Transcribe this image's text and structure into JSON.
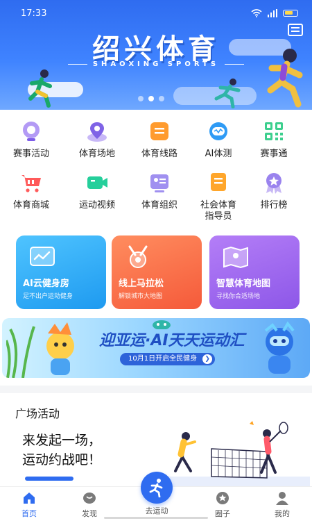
{
  "status_bar": {
    "time": "17:33"
  },
  "hero": {
    "title": "绍兴体育",
    "subtitle": "SHAOXING SPORTS",
    "slide_count": 3,
    "active_slide": 1
  },
  "grid": {
    "items": [
      {
        "label": "赛事活动",
        "icon": "trophy-icon"
      },
      {
        "label": "体育场地",
        "icon": "location-pin-icon"
      },
      {
        "label": "体育线路",
        "icon": "route-icon"
      },
      {
        "label": "AI体测",
        "icon": "ai-robot-icon"
      },
      {
        "label": "赛事通",
        "icon": "qr-code-icon"
      },
      {
        "label": "体育商城",
        "icon": "shopping-cart-icon"
      },
      {
        "label": "运动视频",
        "icon": "video-camera-icon"
      },
      {
        "label": "体育组织",
        "icon": "organization-card-icon"
      },
      {
        "label": "社会体育\n指导员",
        "label_line1": "社会体育",
        "label_line2": "指导员",
        "icon": "instructor-badge-icon"
      },
      {
        "label": "排行榜",
        "icon": "ranking-medal-icon"
      }
    ]
  },
  "cards": [
    {
      "title": "AI云健身房",
      "desc": "足不出户运动健身",
      "color": "#26a9f2",
      "icon": "chart-board-icon"
    },
    {
      "title": "线上马拉松",
      "desc": "解锁城市大地图",
      "color": "#fb6d4a",
      "icon": "medal-icon"
    },
    {
      "title": "智慧体育地图",
      "desc": "寻找你合适场地",
      "color": "#a46af0",
      "icon": "map-icon"
    }
  ],
  "promo": {
    "title": "迎亚运·AI天天运动汇",
    "pill": "10月1日开启全民健身",
    "go_icon": "arrow-right-icon"
  },
  "square": {
    "heading": "广场活动",
    "line1": "来发起一场，",
    "line2": "运动约战吧！"
  },
  "nav": {
    "items": [
      {
        "label": "首页",
        "icon": "home-icon",
        "active": true
      },
      {
        "label": "发现",
        "icon": "discover-icon",
        "active": false
      },
      {
        "label": "去运动",
        "icon": "running-icon",
        "active": false
      },
      {
        "label": "圈子",
        "icon": "star-circle-icon",
        "active": false
      },
      {
        "label": "我的",
        "icon": "user-icon",
        "active": false
      }
    ]
  },
  "colors": {
    "accent": "#2f6cf0",
    "hero_top": "#2f6cf0",
    "card_ai": "#26a9f2",
    "card_marathon": "#fb6d4a",
    "card_map": "#a46af0"
  }
}
